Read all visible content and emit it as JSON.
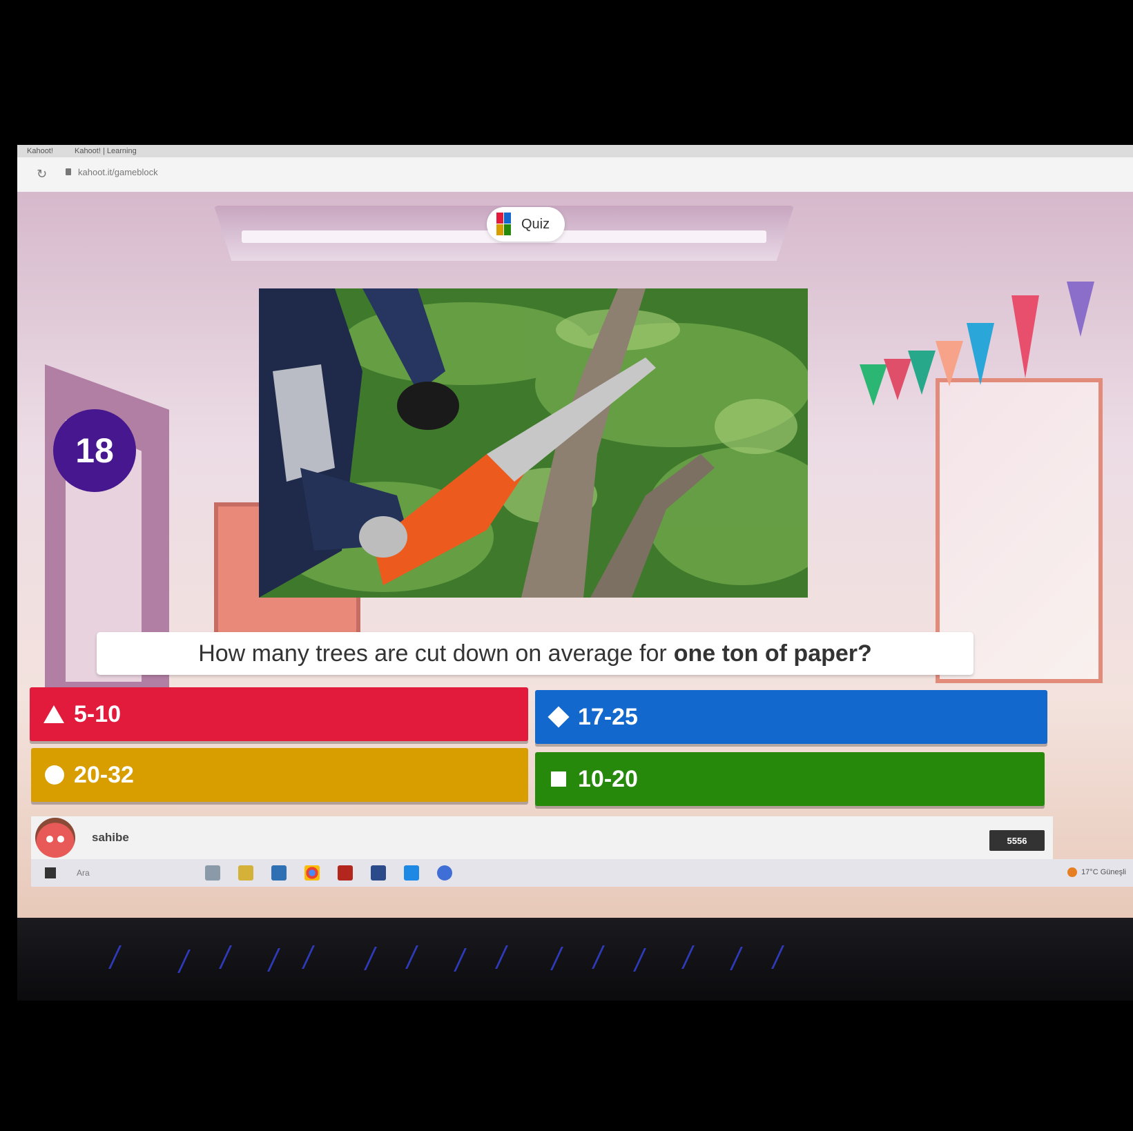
{
  "browser": {
    "tabs": [
      "Kahoot!",
      "Kahoot! | Learning"
    ],
    "url": "kahoot.it/gameblock"
  },
  "game": {
    "mode_label": "Quiz",
    "timer": "18",
    "question": {
      "text": "How many trees are cut down on average for",
      "emphasis": "one ton of paper?"
    },
    "answers": [
      {
        "label": "5-10",
        "shape": "triangle-icon",
        "color": "#e21b3c"
      },
      {
        "label": "17-25",
        "shape": "diamond-icon",
        "color": "#1368ce"
      },
      {
        "label": "20-32",
        "shape": "circle-icon",
        "color": "#d89e00"
      },
      {
        "label": "10-20",
        "shape": "square-icon",
        "color": "#26890c"
      }
    ],
    "player": {
      "nickname": "sahibe",
      "score": "5556"
    }
  },
  "taskbar": {
    "search_placeholder": "Ara",
    "weather": "17°C Güneşli"
  }
}
